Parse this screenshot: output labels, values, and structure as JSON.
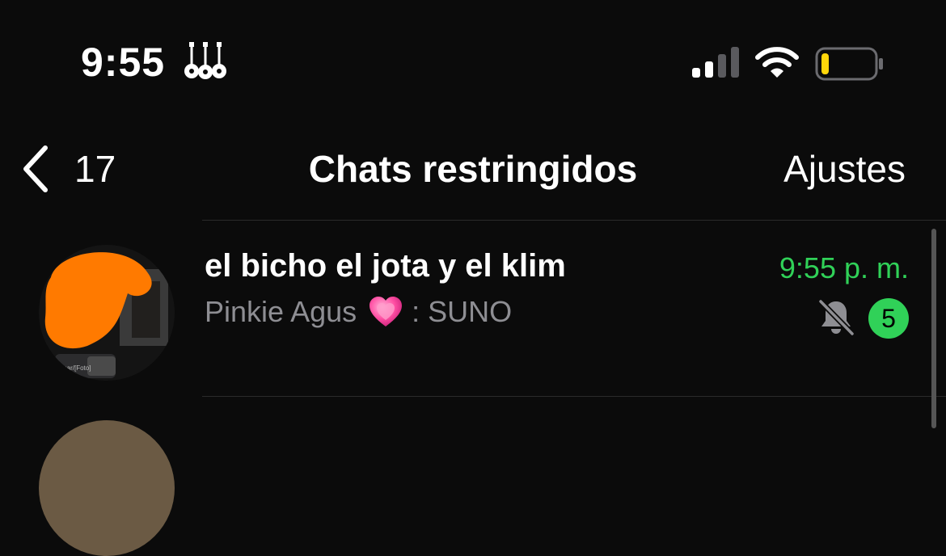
{
  "status_bar": {
    "time": "9:55",
    "emblem": "guitar-trio-icon",
    "signal": "cellular-signal-icon",
    "wifi": "wifi-icon",
    "battery": "battery-low-icon",
    "battery_level": 0.15,
    "battery_color": "#ffd60a"
  },
  "nav": {
    "back_count": "17",
    "title": "Chats restringidos",
    "settings_label": "Ajustes"
  },
  "chats": [
    {
      "name": "el bicho el jota y el klim",
      "preview_sender": "Pinkie Agus",
      "preview_emoji": "pink-heart-icon",
      "preview_text": ": SUNO",
      "time": "9:55 p. m.",
      "muted": true,
      "unread_count": "5",
      "avatar_caption": "mar/[Foto]"
    }
  ],
  "colors": {
    "background": "#0b0b0b",
    "accent_green": "#30d158",
    "secondary_text": "#8e8e93",
    "avatar_redaction": "#ff7a00"
  }
}
